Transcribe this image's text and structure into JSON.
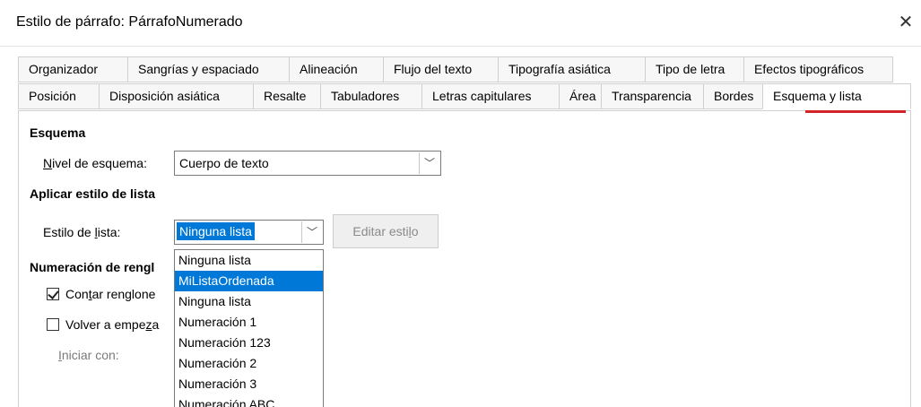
{
  "window": {
    "title": "Estilo de párrafo: PárrafoNumerado",
    "close_glyph": "✕"
  },
  "tabs": {
    "row1": [
      "Organizador",
      "Sangrías y espaciado",
      "Alineación",
      "Flujo del texto",
      "Tipografía asiática",
      "Tipo de letra",
      "Efectos tipográficos"
    ],
    "row2": [
      "Posición",
      "Disposición asiática",
      "Resalte",
      "Tabuladores",
      "Letras capitulares",
      "Área",
      "Transparencia",
      "Bordes",
      "Esquema y lista"
    ],
    "active": "Esquema y lista"
  },
  "outline": {
    "heading": "Esquema",
    "level_label": "Nivel de esquema:",
    "level_value": "Cuerpo de texto"
  },
  "list_style": {
    "heading": "Aplicar estilo de lista",
    "label": "Estilo de lista:",
    "value": "Ninguna lista",
    "edit_button": "Editar estilo",
    "options": [
      "Ninguna lista",
      "MiListaOrdenada",
      "Ninguna lista",
      "Numeración 1",
      "Numeración 123",
      "Numeración 2",
      "Numeración 3",
      "Numeración ABC"
    ],
    "highlighted_index": 1
  },
  "line_numbering": {
    "heading": "Numeración de rengl",
    "count_label": "Contar renglone",
    "count_checked": true,
    "restart_label": "Volver a empeza",
    "restart_checked": false,
    "start_label": "Iniciar con:"
  },
  "colors": {
    "accent": "#0078d7",
    "active_tab_underline": "#d2232a"
  }
}
